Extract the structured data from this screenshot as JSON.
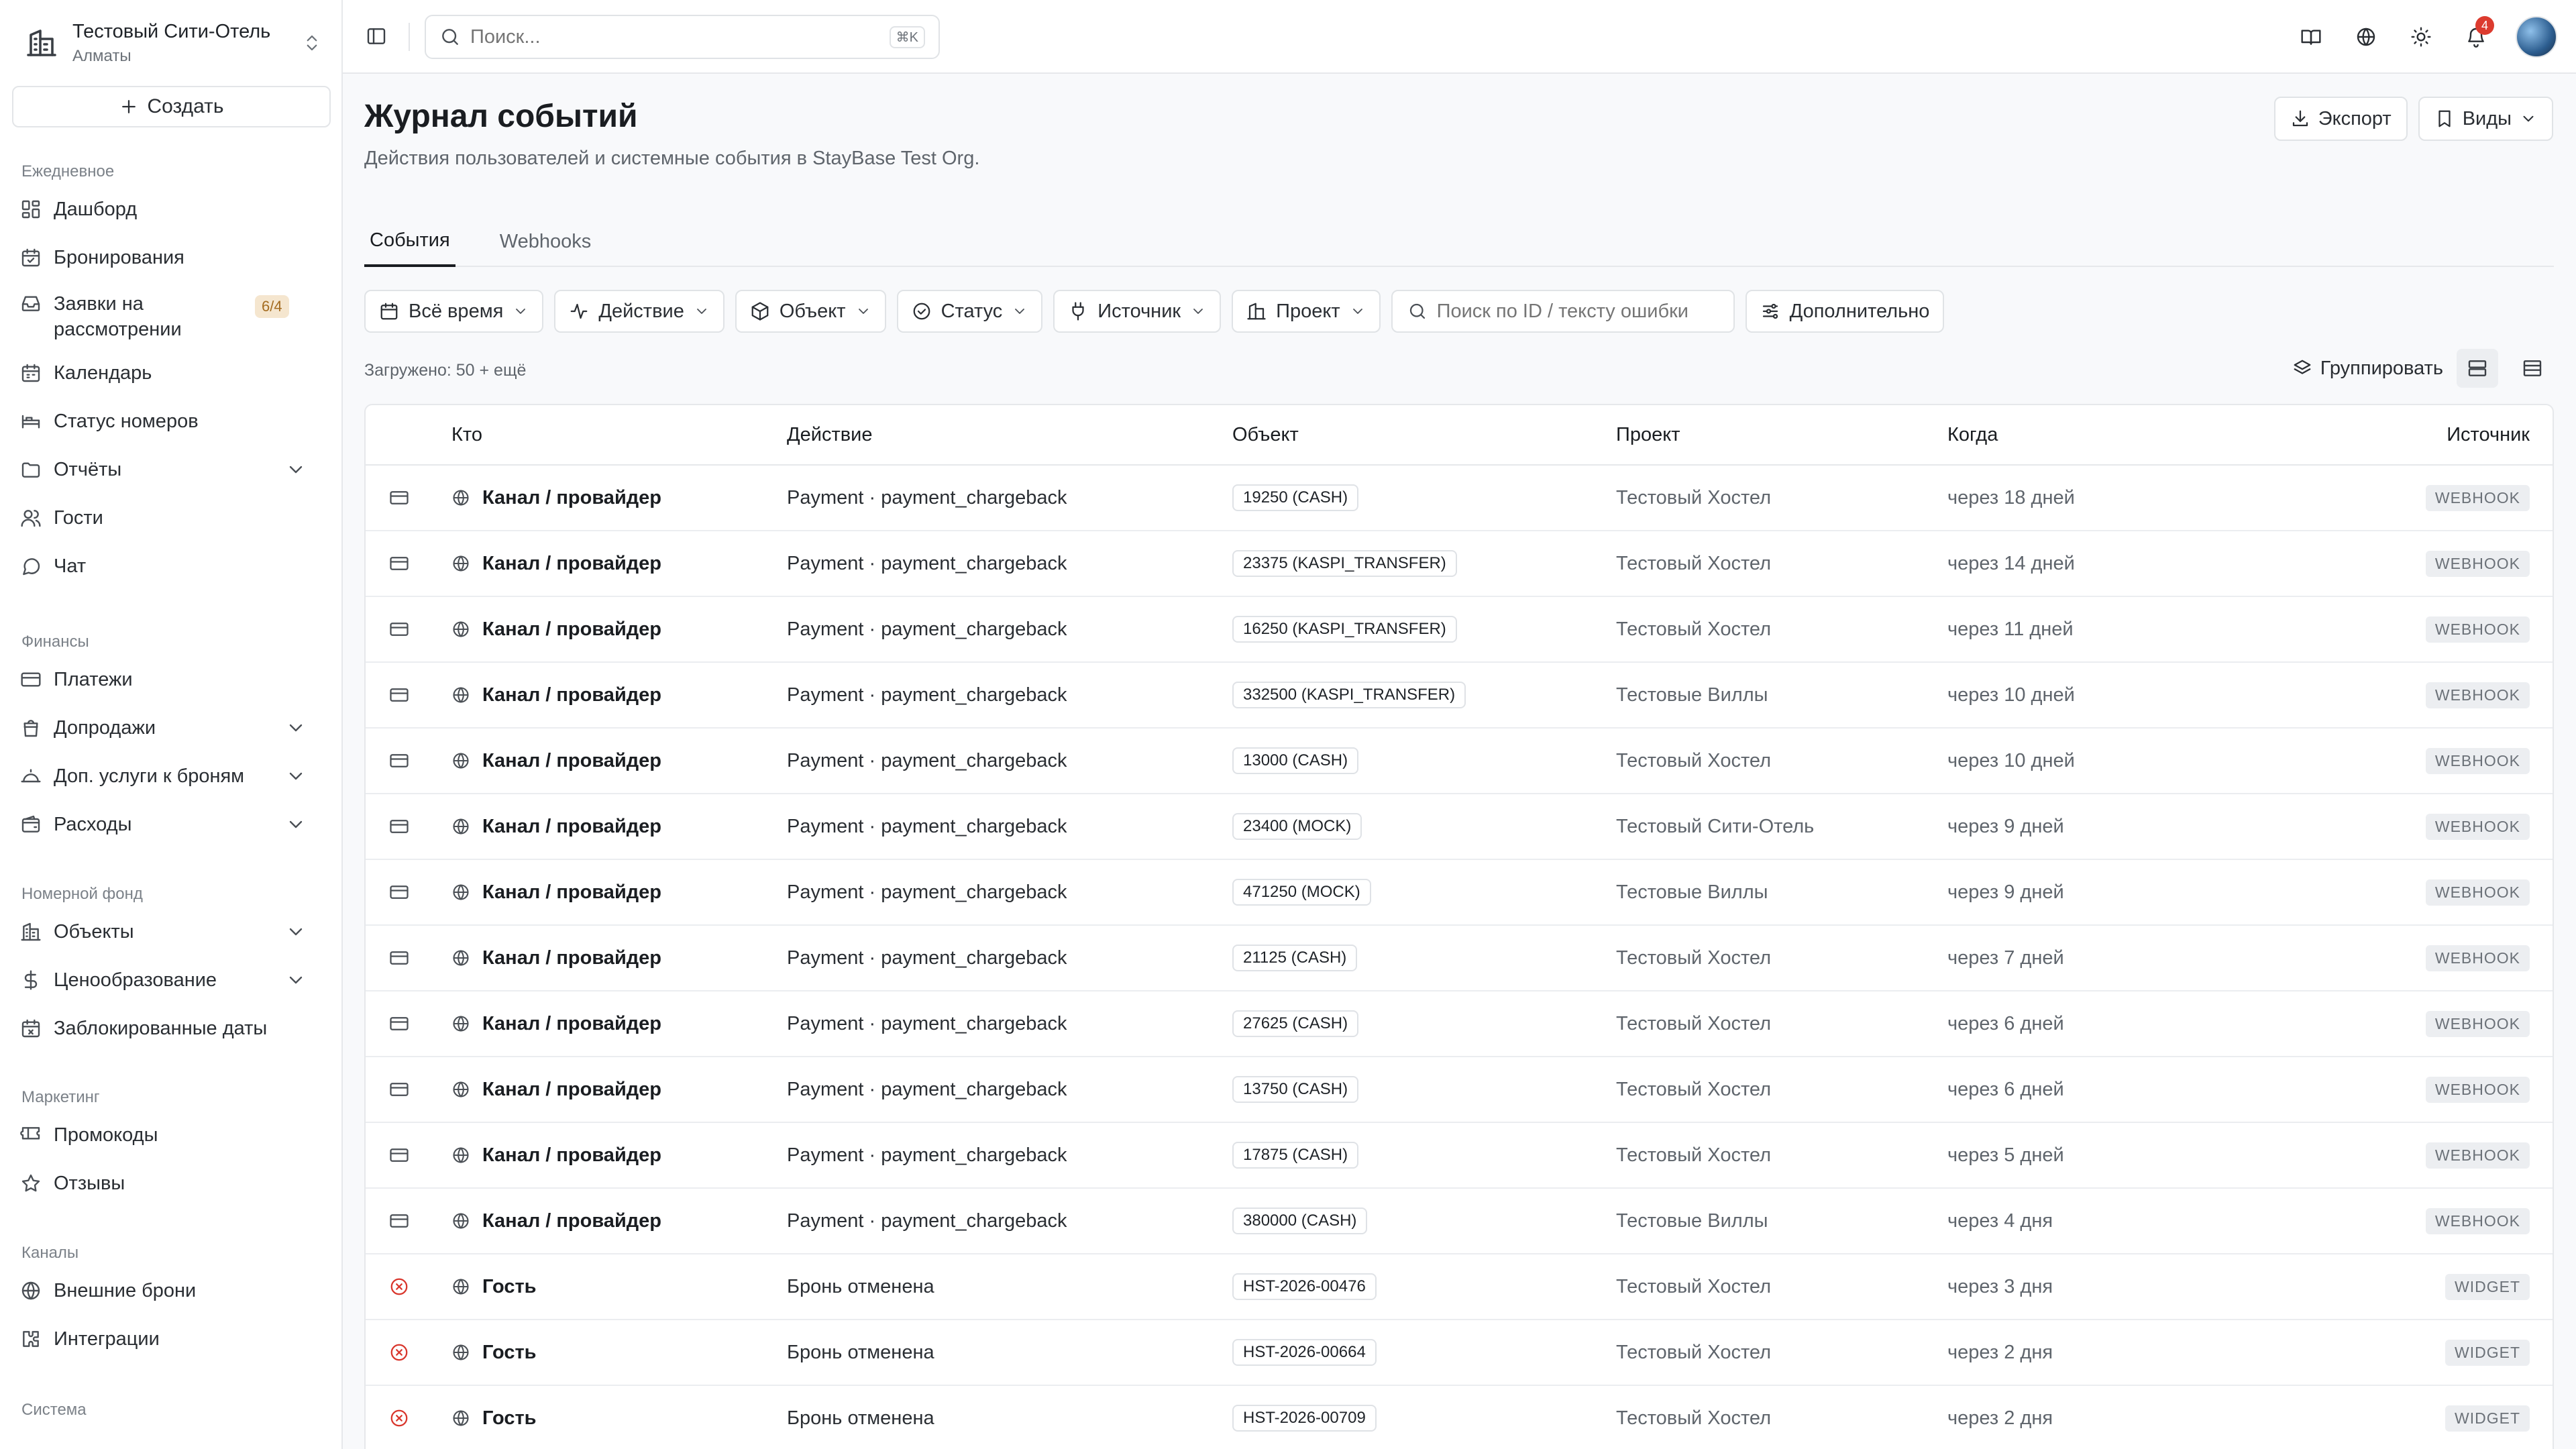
{
  "org": {
    "name": "Тестовый Сити-Отель",
    "city": "Алматы"
  },
  "sidebar": {
    "create_label": "Создать",
    "sections": [
      {
        "title": "Ежедневное",
        "items": [
          {
            "label": "Дашборд",
            "icon": "dashboard-icon"
          },
          {
            "label": "Бронирования",
            "icon": "calendar-check-icon"
          },
          {
            "label": "Заявки на рассмотрении",
            "icon": "inbox-icon",
            "badge": "6/4"
          },
          {
            "label": "Календарь",
            "icon": "calendar-icon"
          },
          {
            "label": "Статус номеров",
            "icon": "bed-icon"
          },
          {
            "label": "Отчёты",
            "icon": "folder-icon",
            "expandable": true
          },
          {
            "label": "Гости",
            "icon": "users-icon"
          },
          {
            "label": "Чат",
            "icon": "chat-icon"
          }
        ]
      },
      {
        "title": "Финансы",
        "items": [
          {
            "label": "Платежи",
            "icon": "credit-card-icon"
          },
          {
            "label": "Допродажи",
            "icon": "shopping-bag-icon",
            "expandable": true
          },
          {
            "label": "Доп. услуги к броням",
            "icon": "service-bell-icon",
            "expandable": true
          },
          {
            "label": "Расходы",
            "icon": "wallet-icon",
            "expandable": true
          }
        ]
      },
      {
        "title": "Номерной фонд",
        "items": [
          {
            "label": "Объекты",
            "icon": "building-icon",
            "expandable": true
          },
          {
            "label": "Ценообразование",
            "icon": "dollar-icon",
            "expandable": true
          },
          {
            "label": "Заблокированные даты",
            "icon": "calendar-x-icon"
          }
        ]
      },
      {
        "title": "Маркетинг",
        "items": [
          {
            "label": "Промокоды",
            "icon": "ticket-icon"
          },
          {
            "label": "Отзывы",
            "icon": "star-icon"
          }
        ]
      },
      {
        "title": "Каналы",
        "items": [
          {
            "label": "Внешние брони",
            "icon": "globe-icon"
          },
          {
            "label": "Интеграции",
            "icon": "puzzle-icon"
          }
        ]
      },
      {
        "title": "Система",
        "items": []
      }
    ]
  },
  "topbar": {
    "search_placeholder": "Поиск...",
    "search_shortcut": "⌘K",
    "notif_count": "4"
  },
  "page": {
    "title": "Журнал событий",
    "subtitle": "Действия пользователей и системные события в StayBase Test Org.",
    "export_label": "Экспорт",
    "views_label": "Виды",
    "tabs": [
      "События",
      "Webhooks"
    ],
    "filters": [
      {
        "label": "Всё время",
        "icon": "calendar-icon"
      },
      {
        "label": "Действие",
        "icon": "activity-icon"
      },
      {
        "label": "Объект",
        "icon": "box-icon"
      },
      {
        "label": "Статус",
        "icon": "check-circle-icon"
      },
      {
        "label": "Источник",
        "icon": "plug-icon"
      },
      {
        "label": "Проект",
        "icon": "building-icon"
      }
    ],
    "search_placeholder": "Поиск по ID / тексту ошибки",
    "more_label": "Дополнительно",
    "loaded_text": "Загружено: 50 + ещё",
    "group_label": "Группировать"
  },
  "table": {
    "columns": [
      "Кто",
      "Действие",
      "Объект",
      "Проект",
      "Когда",
      "Источник"
    ],
    "rows": [
      {
        "type": "payment",
        "who": "Канал / провайдер",
        "action": "Payment · payment_chargeback",
        "object": "19250 (CASH)",
        "project": "Тестовый Хостел",
        "when": "через 18 дней",
        "source": "WEBHOOK"
      },
      {
        "type": "payment",
        "who": "Канал / провайдер",
        "action": "Payment · payment_chargeback",
        "object": "23375 (KASPI_TRANSFER)",
        "project": "Тестовый Хостел",
        "when": "через 14 дней",
        "source": "WEBHOOK"
      },
      {
        "type": "payment",
        "who": "Канал / провайдер",
        "action": "Payment · payment_chargeback",
        "object": "16250 (KASPI_TRANSFER)",
        "project": "Тестовый Хостел",
        "when": "через 11 дней",
        "source": "WEBHOOK"
      },
      {
        "type": "payment",
        "who": "Канал / провайдер",
        "action": "Payment · payment_chargeback",
        "object": "332500 (KASPI_TRANSFER)",
        "project": "Тестовые Виллы",
        "when": "через 10 дней",
        "source": "WEBHOOK"
      },
      {
        "type": "payment",
        "who": "Канал / провайдер",
        "action": "Payment · payment_chargeback",
        "object": "13000 (CASH)",
        "project": "Тестовый Хостел",
        "when": "через 10 дней",
        "source": "WEBHOOK"
      },
      {
        "type": "payment",
        "who": "Канал / провайдер",
        "action": "Payment · payment_chargeback",
        "object": "23400 (MOCK)",
        "project": "Тестовый Сити-Отель",
        "when": "через 9 дней",
        "source": "WEBHOOK"
      },
      {
        "type": "payment",
        "who": "Канал / провайдер",
        "action": "Payment · payment_chargeback",
        "object": "471250 (MOCK)",
        "project": "Тестовые Виллы",
        "when": "через 9 дней",
        "source": "WEBHOOK"
      },
      {
        "type": "payment",
        "who": "Канал / провайдер",
        "action": "Payment · payment_chargeback",
        "object": "21125 (CASH)",
        "project": "Тестовый Хостел",
        "when": "через 7 дней",
        "source": "WEBHOOK"
      },
      {
        "type": "payment",
        "who": "Канал / провайдер",
        "action": "Payment · payment_chargeback",
        "object": "27625 (CASH)",
        "project": "Тестовый Хостел",
        "when": "через 6 дней",
        "source": "WEBHOOK"
      },
      {
        "type": "payment",
        "who": "Канал / провайдер",
        "action": "Payment · payment_chargeback",
        "object": "13750 (CASH)",
        "project": "Тестовый Хостел",
        "when": "через 6 дней",
        "source": "WEBHOOK"
      },
      {
        "type": "payment",
        "who": "Канал / провайдер",
        "action": "Payment · payment_chargeback",
        "object": "17875 (CASH)",
        "project": "Тестовый Хостел",
        "when": "через 5 дней",
        "source": "WEBHOOK"
      },
      {
        "type": "payment",
        "who": "Канал / провайдер",
        "action": "Payment · payment_chargeback",
        "object": "380000 (CASH)",
        "project": "Тестовые Виллы",
        "when": "через 4 дня",
        "source": "WEBHOOK"
      },
      {
        "type": "cancel",
        "who": "Гость",
        "action": "Бронь отменена",
        "object": "HST-2026-00476",
        "project": "Тестовый Хостел",
        "when": "через 3 дня",
        "source": "WIDGET"
      },
      {
        "type": "cancel",
        "who": "Гость",
        "action": "Бронь отменена",
        "object": "HST-2026-00664",
        "project": "Тестовый Хостел",
        "when": "через 2 дня",
        "source": "WIDGET"
      },
      {
        "type": "cancel",
        "who": "Гость",
        "action": "Бронь отменена",
        "object": "HST-2026-00709",
        "project": "Тестовый Хостел",
        "when": "через 2 дня",
        "source": "WIDGET"
      }
    ]
  },
  "colors": {
    "accent": "#1a1d21",
    "error": "#d9352b",
    "badge_bg": "#f5e6cf",
    "badge_fg": "#a46c20"
  }
}
